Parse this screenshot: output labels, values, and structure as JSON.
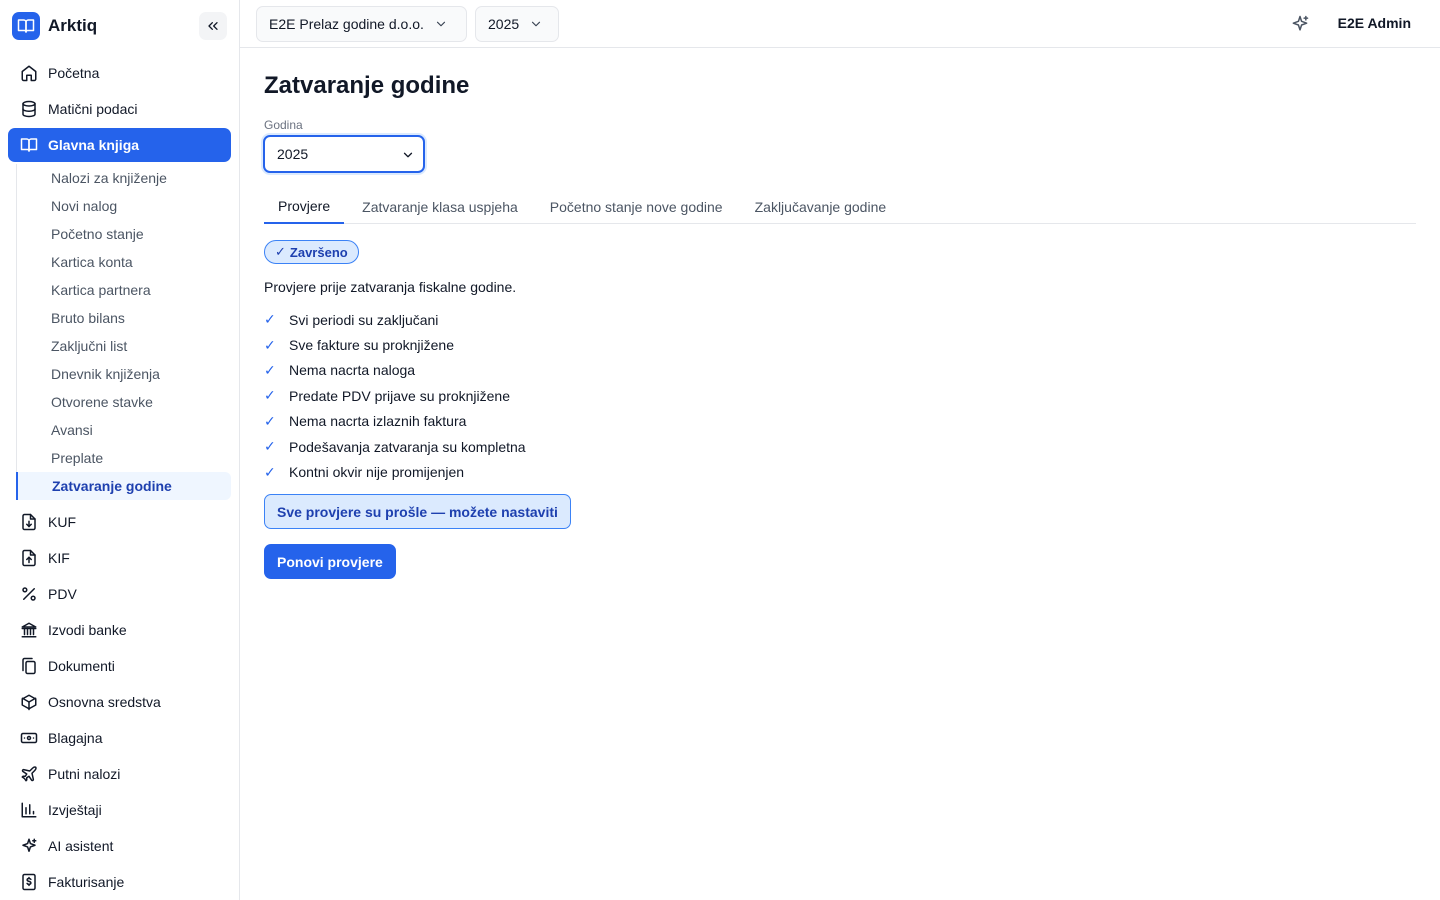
{
  "app": {
    "name": "Arktiq"
  },
  "colors": {
    "accent": "#2563eb",
    "accent_light": "#dbeafe",
    "accent_dark": "#1e40af"
  },
  "topbar": {
    "company": "E2E Prelaz godine d.o.o.",
    "year": "2025",
    "user": "E2E Admin"
  },
  "sidebar": {
    "items_top": [
      {
        "label": "Početna",
        "icon": "home-icon"
      },
      {
        "label": "Matični podaci",
        "icon": "database-icon"
      },
      {
        "label": "Glavna knjiga",
        "icon": "book-icon"
      }
    ],
    "sub_items": [
      "Nalozi za knjiženje",
      "Novi nalog",
      "Početno stanje",
      "Kartica konta",
      "Kartica partnera",
      "Bruto bilans",
      "Zaključni list",
      "Dnevnik knjiženja",
      "Otvorene stavke",
      "Avansi",
      "Preplate",
      "Zatvaranje godine"
    ],
    "items_bottom": [
      {
        "label": "KUF",
        "icon": "file-download-icon"
      },
      {
        "label": "KIF",
        "icon": "file-upload-icon"
      },
      {
        "label": "PDV",
        "icon": "percent-icon"
      },
      {
        "label": "Izvodi banke",
        "icon": "bank-icon"
      },
      {
        "label": "Dokumenti",
        "icon": "documents-icon"
      },
      {
        "label": "Osnovna sredstva",
        "icon": "box-icon"
      },
      {
        "label": "Blagajna",
        "icon": "cash-icon"
      },
      {
        "label": "Putni nalozi",
        "icon": "plane-icon"
      },
      {
        "label": "Izvještaji",
        "icon": "bar-chart-icon"
      },
      {
        "label": "AI asistent",
        "icon": "sparkles-icon"
      },
      {
        "label": "Fakturisanje",
        "icon": "invoice-icon"
      }
    ]
  },
  "main": {
    "title": "Zatvaranje godine",
    "year_label": "Godina",
    "year_value": "2025",
    "tabs": [
      "Provjere",
      "Zatvaranje klasa uspjeha",
      "Početno stanje nove godine",
      "Zaključavanje godine"
    ],
    "status_badge": "Završeno",
    "check_mark": "✓",
    "description": "Provjere prije zatvaranja fiskalne godine.",
    "checks": [
      "Svi periodi su zaključani",
      "Sve fakture su proknjižene",
      "Nema nacrta naloga",
      "Predate PDV prijave su proknjižene",
      "Nema nacrta izlaznih faktura",
      "Podešavanja zatvaranja su kompletna",
      "Kontni okvir nije promijenjen"
    ],
    "success_message": "Sve provjere su prošle — možete nastaviti",
    "retry_button": "Ponovi provjere"
  }
}
